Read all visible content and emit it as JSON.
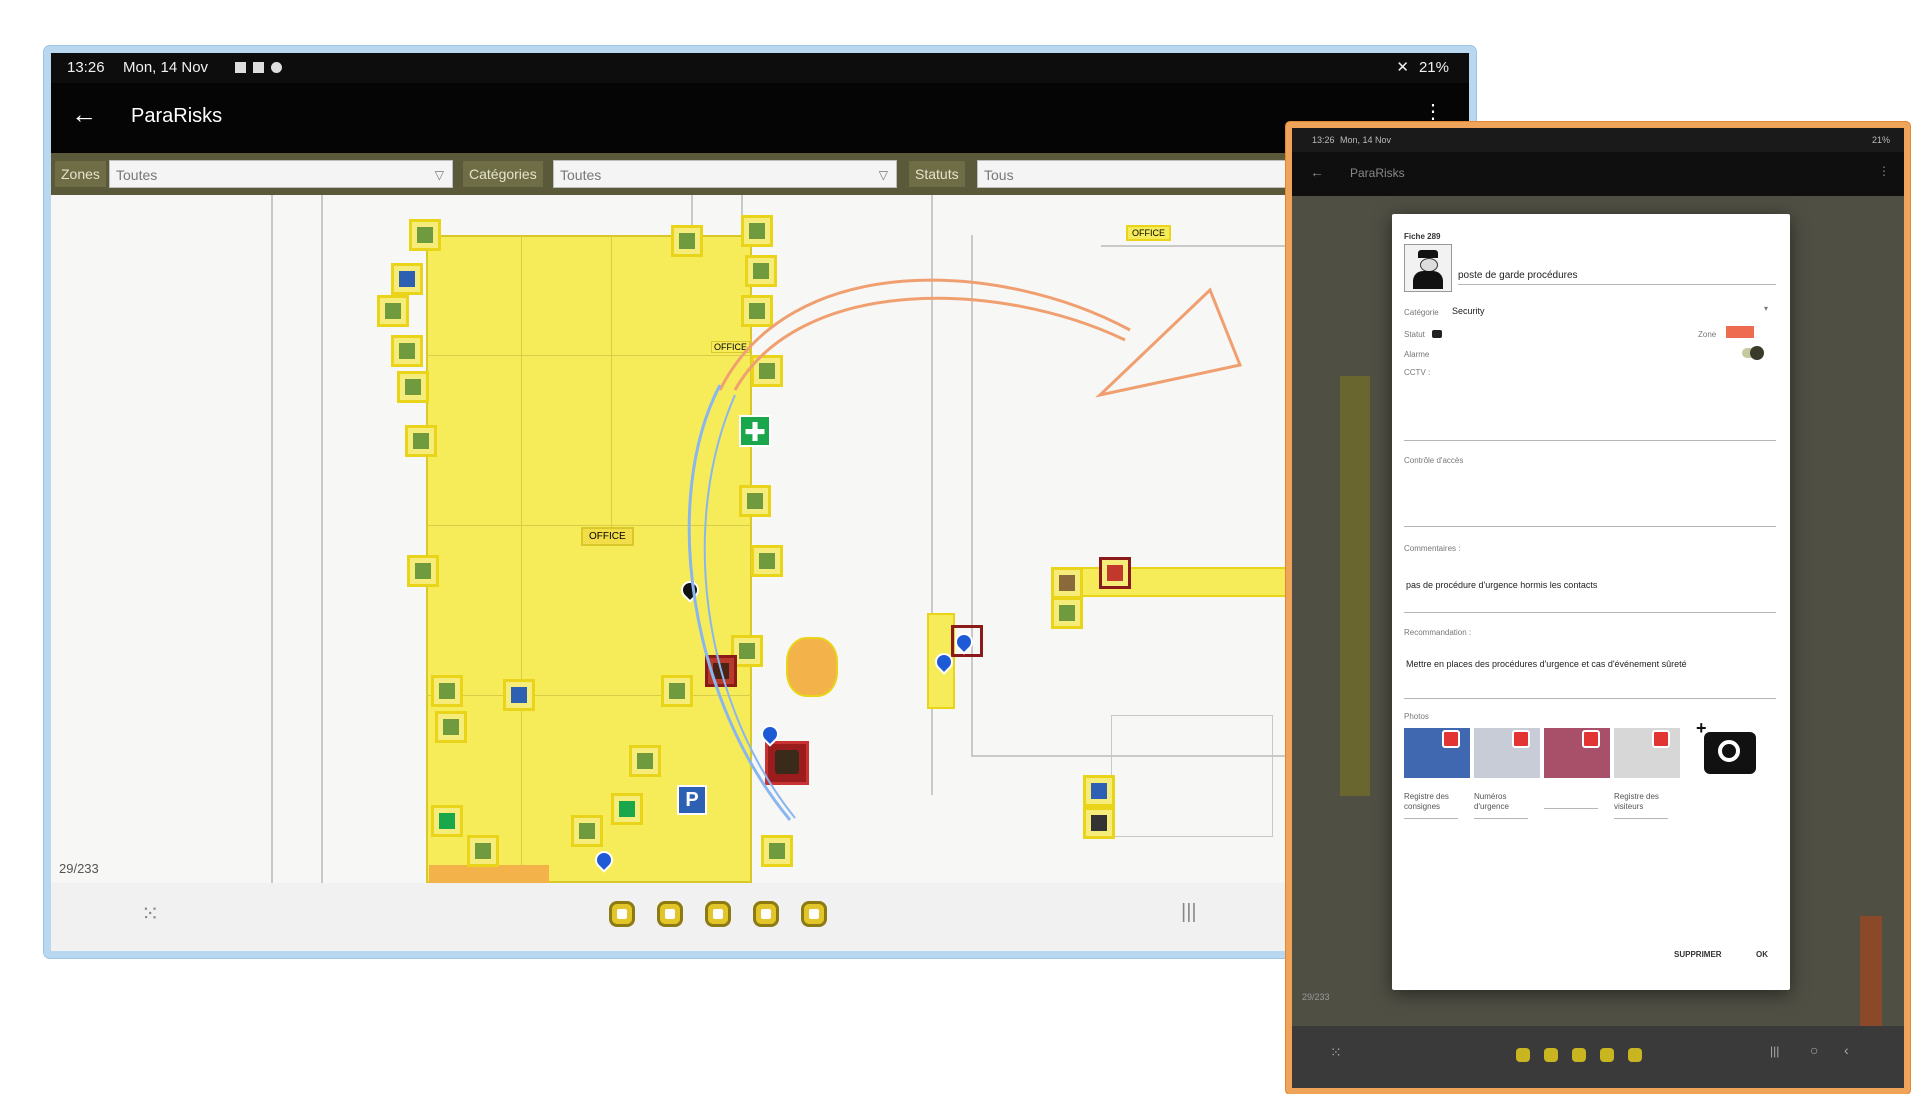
{
  "status_bar": {
    "time": "13:26",
    "date": "Mon, 14 Nov",
    "battery": "21%"
  },
  "app": {
    "title": "ParaRisks",
    "back_icon": "arrow-left-icon",
    "menu_icon": "more-vert-icon"
  },
  "filters": {
    "zones_label": "Zones",
    "zones_value": "Toutes",
    "categories_label": "Catégories",
    "categories_value": "Toutes",
    "statuts_label": "Statuts",
    "statuts_value": "Tous"
  },
  "map": {
    "page_counter": "29/233",
    "labels": {
      "office_1": "OFFICE",
      "office_2": "OFFICE",
      "zone_tag": "OFFICE"
    }
  },
  "colors": {
    "zone_yellow": "#f6ec5a",
    "accent_green": "#1aa64a",
    "accent_red": "#e33434",
    "frame_blue": "#b9d8f0",
    "frame_orange": "#f0a45a",
    "arrow_orange": "#f0a070",
    "arrow_blue": "#8ab6f0"
  },
  "dialog": {
    "title": "Fiche 289",
    "name": "poste de garde procédures",
    "category_label": "Catégorie",
    "category_value": "Security",
    "statut_label": "Statut",
    "zone_label": "Zone",
    "alarme_label": "Alarme",
    "cctv_label": "CCTV :",
    "controle_label": "Contrôle d'accès",
    "commentaires_label": "Commentaires :",
    "commentaires_value": "pas de procédure d'urgence hormis les contacts",
    "recommandation_label": "Recommandation :",
    "recommandation_value": "Mettre en places des procédures d'urgence et cas d'événement sûreté",
    "photos_label": "Photos",
    "photo_captions": [
      "Registre des consignes",
      "Numéros d'urgence",
      "",
      "Registre des visiteurs"
    ],
    "delete_button": "SUPPRIMER",
    "ok_button": "OK"
  },
  "right_tablet": {
    "page_counter": "29/233"
  }
}
